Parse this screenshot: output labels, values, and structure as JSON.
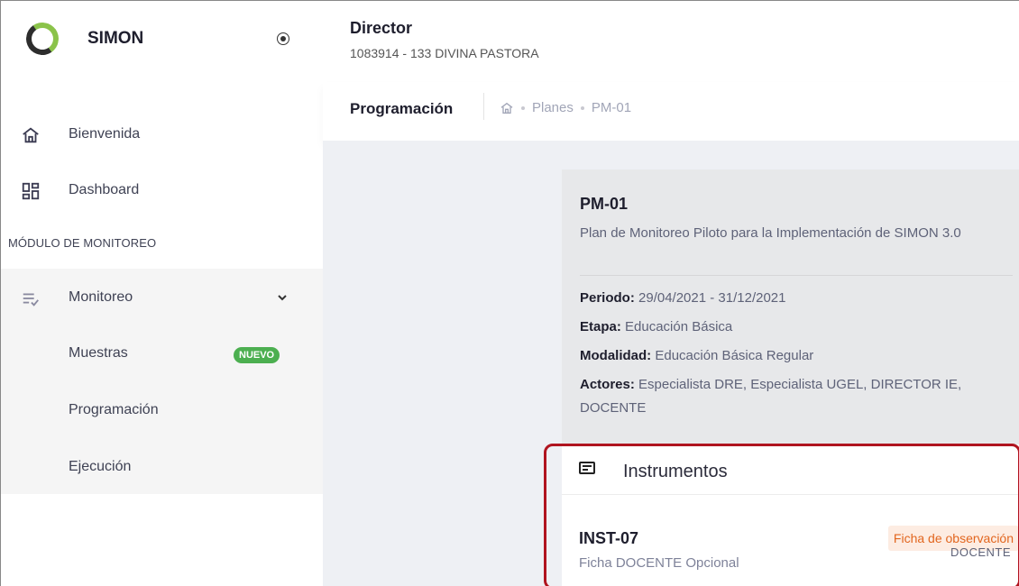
{
  "app": {
    "name": "SIMON"
  },
  "header": {
    "role": "Director",
    "school": "1083914 - 133 DIVINA PASTORA"
  },
  "subheader": {
    "page_title": "Programación",
    "breadcrumb": [
      "Planes",
      "PM-01"
    ]
  },
  "sidebar": {
    "items": [
      {
        "label": "Bienvenida",
        "icon": "home-icon"
      },
      {
        "label": "Dashboard",
        "icon": "dashboard-icon"
      }
    ],
    "section_title": "MÓDULO DE MONITOREO",
    "monitoreo": {
      "label": "Monitoreo",
      "icon": "checklist-icon",
      "children": [
        {
          "label": "Muestras",
          "badge": "NUEVO"
        },
        {
          "label": "Programación"
        },
        {
          "label": "Ejecución"
        }
      ]
    }
  },
  "plan": {
    "code": "PM-01",
    "description": "Plan de Monitoreo Piloto para la Implementación de SIMON 3.0",
    "periodo_label": "Periodo:",
    "periodo": "29/04/2021 - 31/12/2021",
    "etapa_label": "Etapa:",
    "etapa": "Educación Básica",
    "modalidad_label": "Modalidad:",
    "modalidad": "Educación Básica Regular",
    "actores_label": "Actores:",
    "actores": "Especialista DRE, Especialista UGEL, DIRECTOR IE, DOCENTE"
  },
  "instrumentos": {
    "title": "Instrumentos",
    "items": [
      {
        "code": "INST-07",
        "description": "Ficha DOCENTE Opcional",
        "type": "Ficha de observación",
        "actor": "DOCENTE"
      }
    ]
  },
  "colors": {
    "badge_green": "#4caf50",
    "highlight_border": "#b0141f",
    "type_badge_text": "#e2661f"
  }
}
